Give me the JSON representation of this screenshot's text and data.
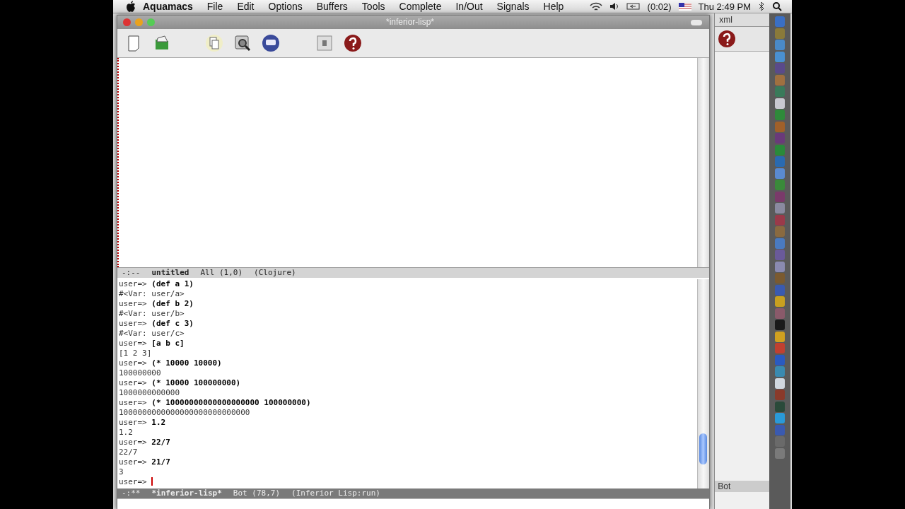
{
  "menubar": {
    "menus": [
      {
        "label": "Aquamacs",
        "kind": "app"
      },
      {
        "label": "File",
        "kind": "menu"
      },
      {
        "label": "Edit",
        "kind": "menu"
      },
      {
        "label": "Options",
        "kind": "menu"
      },
      {
        "label": "Buffers",
        "kind": "menu"
      },
      {
        "label": "Tools",
        "kind": "menu"
      },
      {
        "label": "Complete",
        "kind": "menu"
      },
      {
        "label": "In/Out",
        "kind": "menu"
      },
      {
        "label": "Signals",
        "kind": "menu"
      },
      {
        "label": "Help",
        "kind": "menu"
      }
    ],
    "battery_time": "(0:02)",
    "clock": "Thu 2:49 PM"
  },
  "window": {
    "title": "*inferior-lisp*",
    "upper_modeline": {
      "status": "-:--",
      "buffer": "untitled",
      "position": "All (1,0)",
      "mode": "(Clojure)"
    },
    "repl_lines": [
      {
        "text": "user=> **(def a 1)**"
      },
      {
        "text": "#<Var: user/a>"
      },
      {
        "text": "user=> **(def b 2)**"
      },
      {
        "text": "#<Var: user/b>"
      },
      {
        "text": "user=> **(def c 3)**"
      },
      {
        "text": "#<Var: user/c>"
      },
      {
        "text": "user=> **[a b c]**"
      },
      {
        "text": "[1 2 3]"
      },
      {
        "text": "user=> **(* 10000 10000)**"
      },
      {
        "text": "100000000"
      },
      {
        "text": "user=> **(* 10000 100000000)**"
      },
      {
        "text": "1000000000000"
      },
      {
        "text": "user=> **(* 10000000000000000000 100000000)**"
      },
      {
        "text": "1000000000000000000000000000"
      },
      {
        "text": "user=> **1.2**"
      },
      {
        "text": "1.2"
      },
      {
        "text": "user=> **22/7**"
      },
      {
        "text": "22/7"
      },
      {
        "text": "user=> **21/7**"
      },
      {
        "text": "3"
      }
    ],
    "prompt": "user=>",
    "lower_modeline": {
      "status": "-:**",
      "buffer": "*inferior-lisp*",
      "position": "Bot (78,7)",
      "mode": "(Inferior Lisp:run)"
    }
  },
  "background_window": {
    "tab": "xml",
    "status": "Bot"
  }
}
